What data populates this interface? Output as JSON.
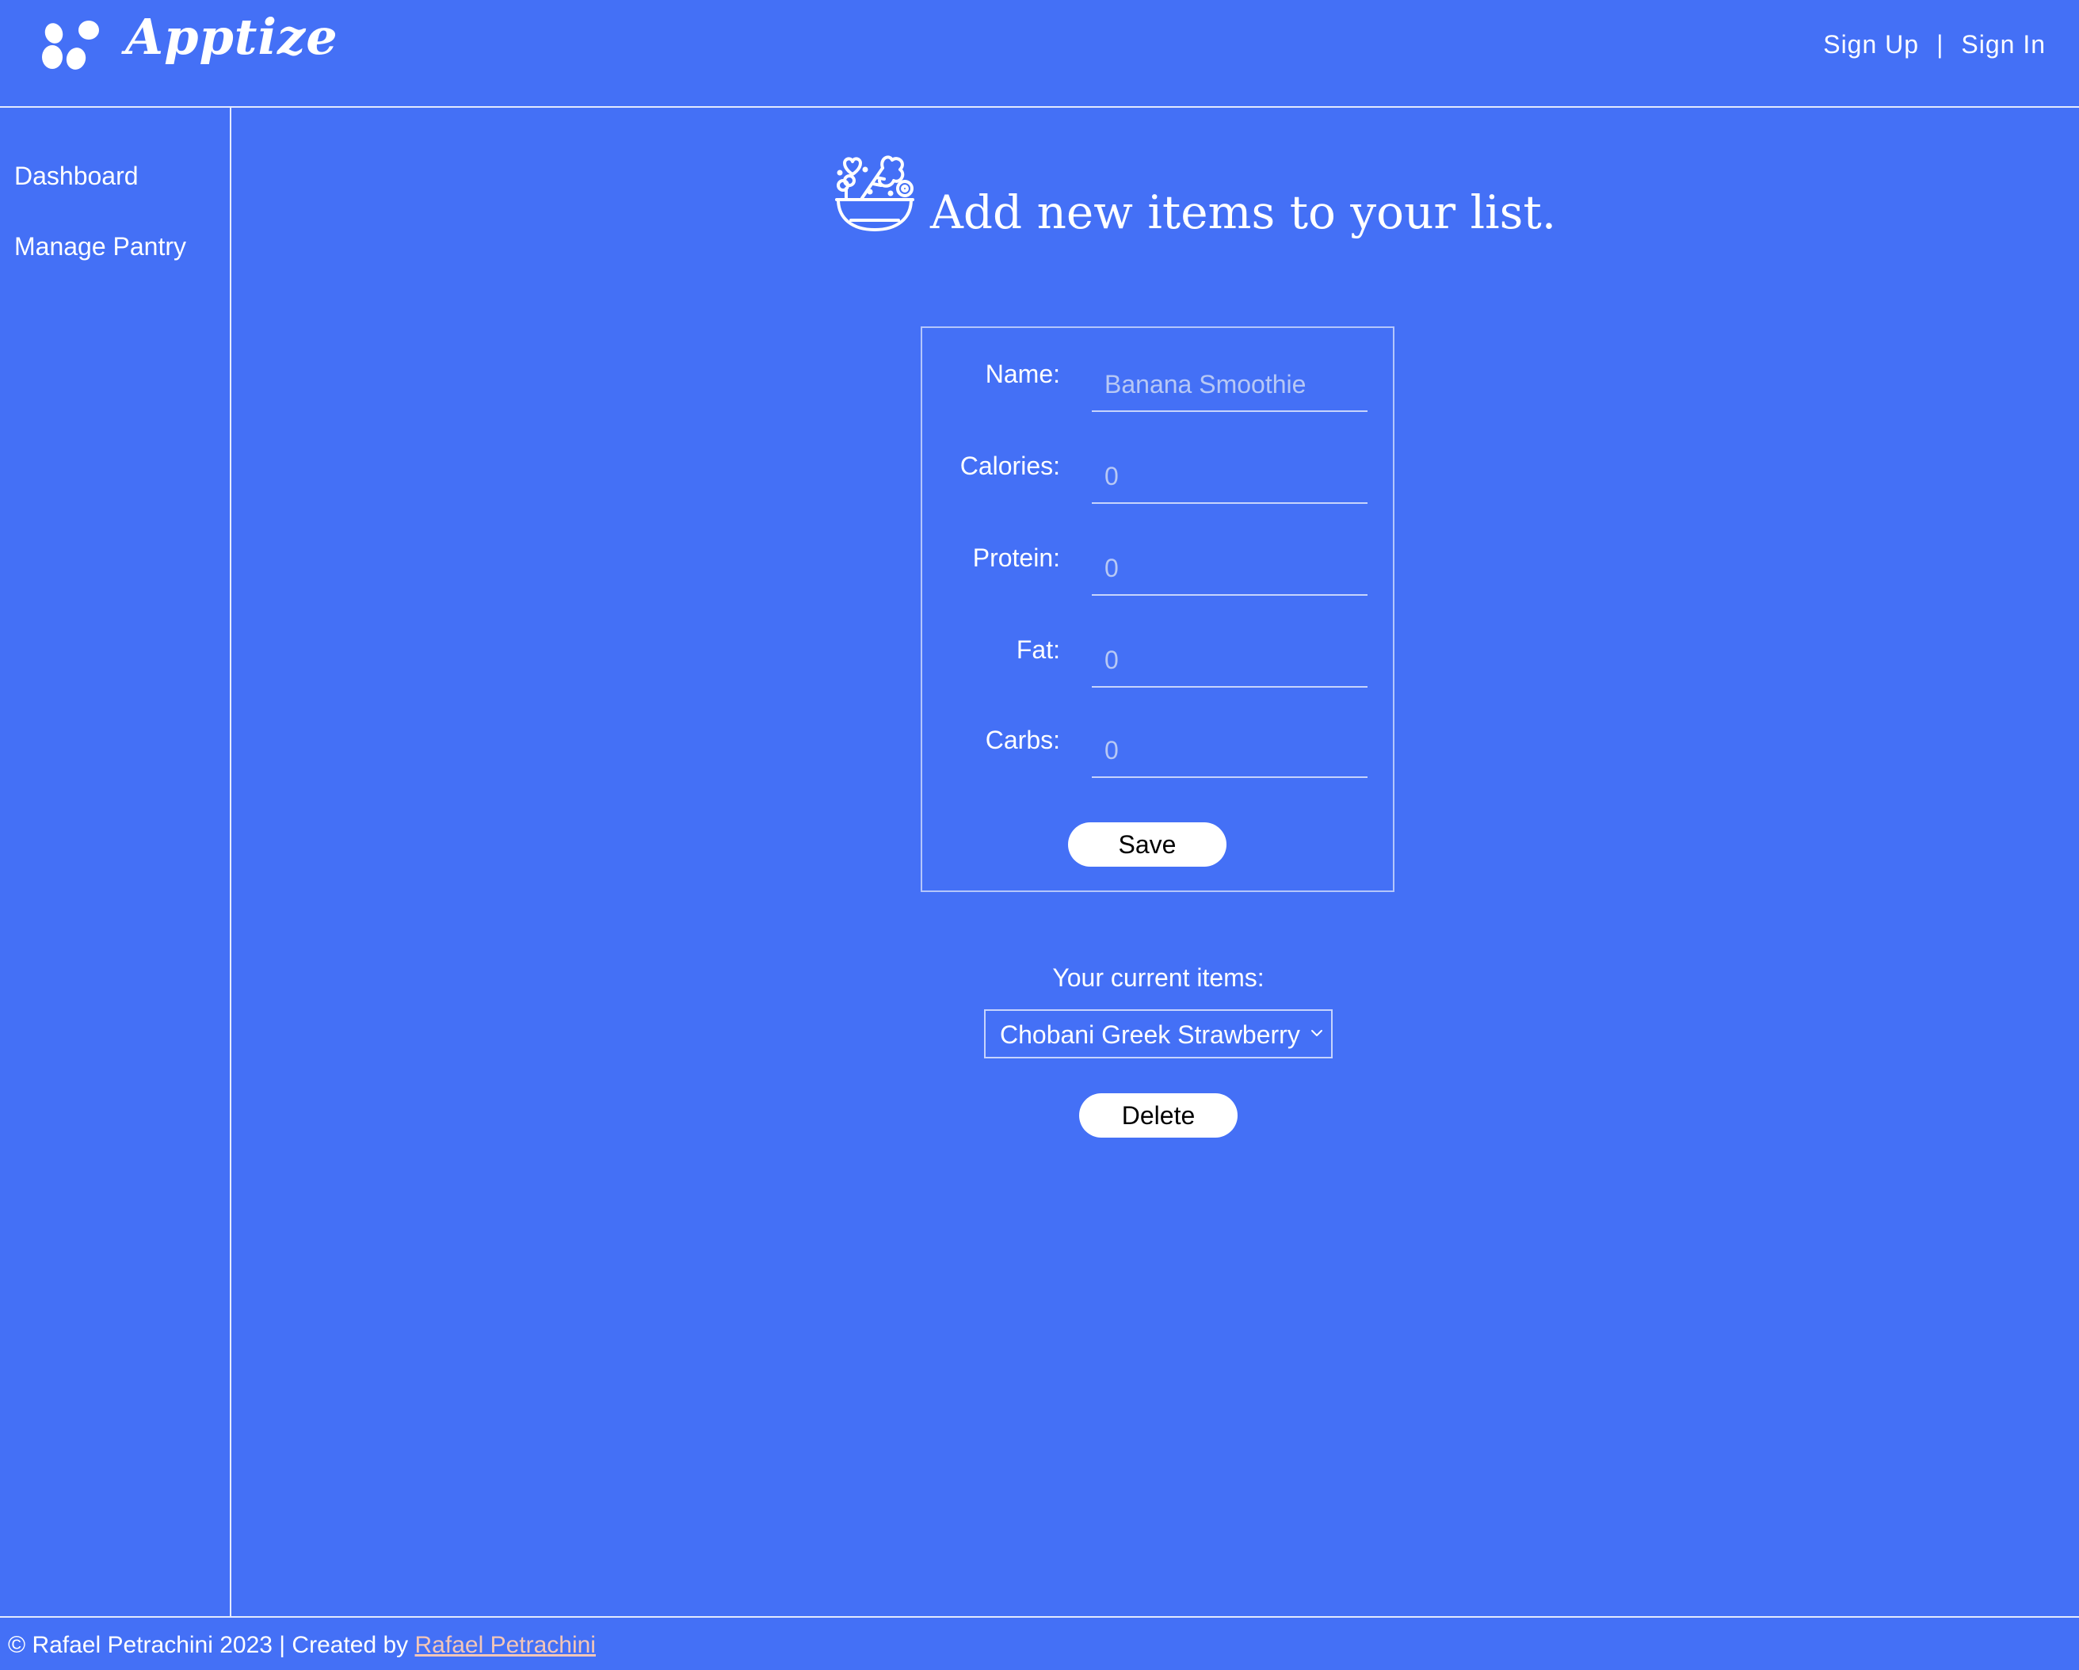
{
  "header": {
    "logo_icon": "paw-dots-icon",
    "brand": "Apptize",
    "sign_up": "Sign Up",
    "separator": "|",
    "sign_in": "Sign In"
  },
  "sidebar": {
    "items": [
      {
        "label": "Dashboard"
      },
      {
        "label": "Manage Pantry"
      }
    ]
  },
  "main": {
    "title_icon": "salad-bowl-icon",
    "title": "Add new items to your list.",
    "form": {
      "fields": [
        {
          "label": "Name:",
          "value": "",
          "placeholder": "Banana Smoothie"
        },
        {
          "label": "Calories:",
          "value": "",
          "placeholder": "0"
        },
        {
          "label": "Protein:",
          "value": "",
          "placeholder": "0"
        },
        {
          "label": "Fat:",
          "value": "",
          "placeholder": "0"
        },
        {
          "label": "Carbs:",
          "value": "",
          "placeholder": "0"
        }
      ],
      "save_label": "Save"
    },
    "current_items_label": "Your current items:",
    "current_items_selected": "Chobani Greek Strawberry",
    "delete_label": "Delete"
  },
  "footer": {
    "text": "© Rafael Petrachini 2023 | Created by ",
    "link_text": "Rafael Petrachini"
  },
  "colors": {
    "background": "#4470f6",
    "text": "#ffffff",
    "footer_link": "#f3c6b8",
    "button_bg": "#ffffff",
    "button_text": "#000000"
  }
}
